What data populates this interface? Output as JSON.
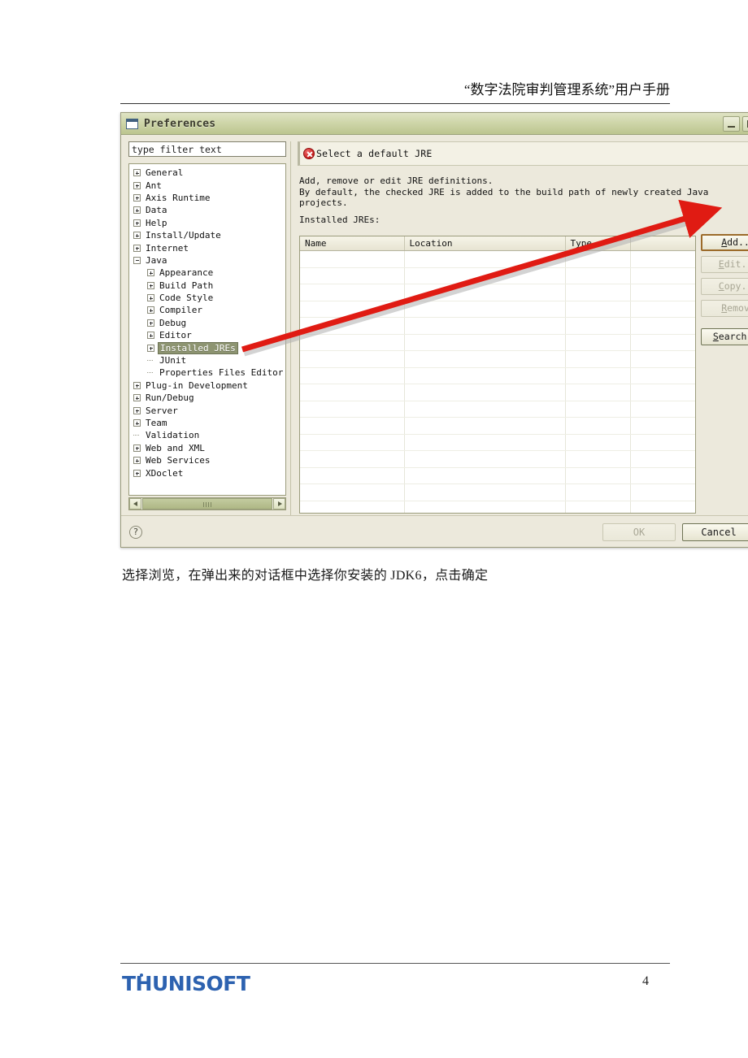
{
  "document": {
    "header_title": "“数字法院审判管理系统”用户手册",
    "caption": "选择浏览，在弹出来的对话框中选择你安装的 JDK6，点击确定",
    "footer_logo": "THUNISOFT",
    "page_number": "4"
  },
  "dialog": {
    "title": "Preferences",
    "window_buttons": {
      "minimize": "minimize-icon",
      "maximize": "maximize-icon"
    },
    "filter": {
      "value": "type filter text",
      "placeholder": "type filter text"
    },
    "tree": [
      {
        "label": "General",
        "indent": 0,
        "marker": "plus"
      },
      {
        "label": "Ant",
        "indent": 0,
        "marker": "plus"
      },
      {
        "label": "Axis Runtime",
        "indent": 0,
        "marker": "plus"
      },
      {
        "label": "Data",
        "indent": 0,
        "marker": "plus"
      },
      {
        "label": "Help",
        "indent": 0,
        "marker": "plus"
      },
      {
        "label": "Install/Update",
        "indent": 0,
        "marker": "plus"
      },
      {
        "label": "Internet",
        "indent": 0,
        "marker": "plus"
      },
      {
        "label": "Java",
        "indent": 0,
        "marker": "minus"
      },
      {
        "label": "Appearance",
        "indent": 1,
        "marker": "plus"
      },
      {
        "label": "Build Path",
        "indent": 1,
        "marker": "plus"
      },
      {
        "label": "Code Style",
        "indent": 1,
        "marker": "plus"
      },
      {
        "label": "Compiler",
        "indent": 1,
        "marker": "plus"
      },
      {
        "label": "Debug",
        "indent": 1,
        "marker": "plus"
      },
      {
        "label": "Editor",
        "indent": 1,
        "marker": "plus"
      },
      {
        "label": "Installed JREs",
        "indent": 1,
        "marker": "plus",
        "selected": true
      },
      {
        "label": "JUnit",
        "indent": 1,
        "marker": "leaf"
      },
      {
        "label": "Properties Files Editor",
        "indent": 1,
        "marker": "leaf"
      },
      {
        "label": "Plug-in Development",
        "indent": 0,
        "marker": "plus"
      },
      {
        "label": "Run/Debug",
        "indent": 0,
        "marker": "plus"
      },
      {
        "label": "Server",
        "indent": 0,
        "marker": "plus"
      },
      {
        "label": "Team",
        "indent": 0,
        "marker": "plus"
      },
      {
        "label": "Validation",
        "indent": 0,
        "marker": "leaf"
      },
      {
        "label": "Web and XML",
        "indent": 0,
        "marker": "plus"
      },
      {
        "label": "Web Services",
        "indent": 0,
        "marker": "plus"
      },
      {
        "label": "XDoclet",
        "indent": 0,
        "marker": "plus"
      }
    ],
    "message": {
      "icon": "error-icon",
      "text": "Select a default JRE"
    },
    "description_line1": "Add, remove or edit JRE definitions.",
    "description_line2": "By default, the checked JRE is added to the build path of newly created Java projects.",
    "installed_label": "Installed JREs:",
    "table": {
      "columns": [
        "Name",
        "Location",
        "Type",
        ""
      ],
      "rows": []
    },
    "side_buttons": [
      {
        "label": "Add...",
        "mnemonic": "A",
        "state": "focused"
      },
      {
        "label": "Edit...",
        "mnemonic": "E",
        "state": "disabled"
      },
      {
        "label": "Copy...",
        "mnemonic": "C",
        "state": "disabled"
      },
      {
        "label": "Remove",
        "mnemonic": "R",
        "state": "disabled"
      },
      {
        "label": "Search...",
        "mnemonic": "S",
        "state": "enabled"
      }
    ],
    "footer_buttons": {
      "help": "?",
      "ok": "OK",
      "ok_state": "disabled",
      "cancel": "Cancel",
      "cancel_state": "enabled"
    },
    "scrollbar": {
      "left_arrow": "chevron-left-icon",
      "right_arrow": "chevron-right-icon"
    }
  },
  "annotation": {
    "arrow_color": "#e01b13",
    "from": "Installed JREs tree item",
    "to": "Add... button"
  }
}
